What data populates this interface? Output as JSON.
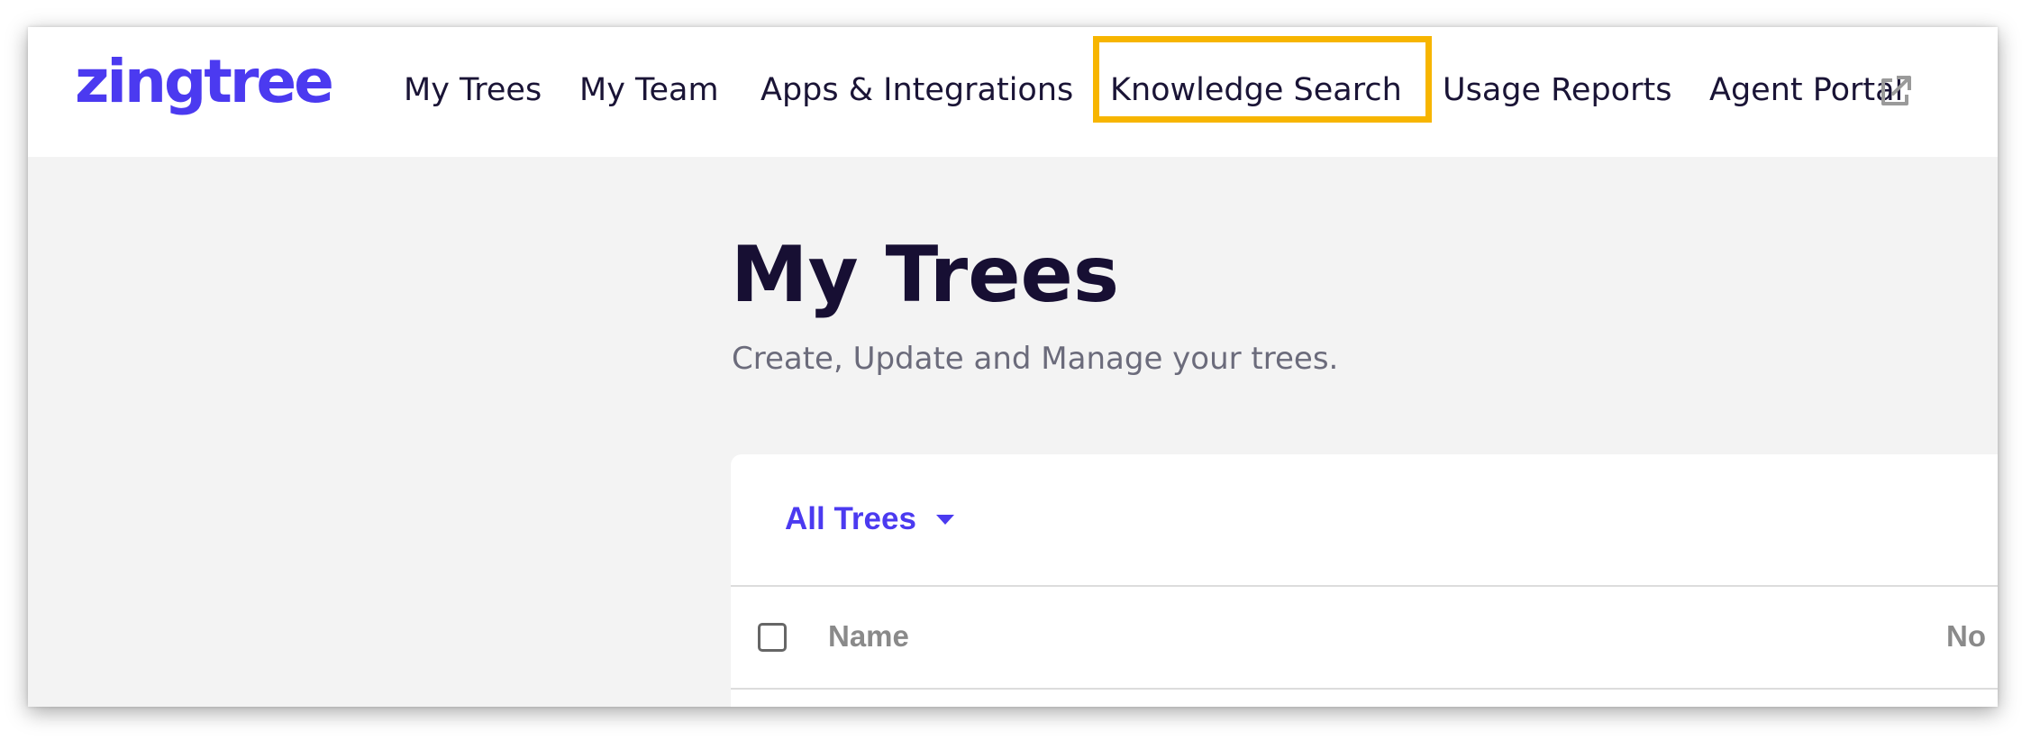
{
  "brand": {
    "logo_text": "zingtree",
    "accent_color": "#4b3af0",
    "highlight_color": "#f7b500"
  },
  "nav": {
    "items": [
      {
        "label": "My Trees"
      },
      {
        "label": "My Team"
      },
      {
        "label": "Apps & Integrations"
      },
      {
        "label": "Knowledge Search"
      },
      {
        "label": "Usage Reports"
      },
      {
        "label": "Agent Portal",
        "icon": "external-link-icon"
      }
    ]
  },
  "page": {
    "title": "My Trees",
    "subtitle": "Create, Update and Manage your trees."
  },
  "filter": {
    "label": "All Trees"
  },
  "table": {
    "columns": [
      "Name",
      "No"
    ]
  }
}
